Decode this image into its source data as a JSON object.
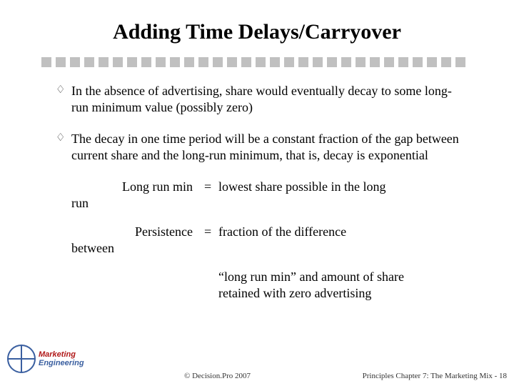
{
  "title": "Adding Time Delays/Carryover",
  "bullets": [
    "In the absence of advertising, share would eventually decay to some long-run minimum value (possibly zero)",
    "The decay in one time period will be a constant fraction of the gap between current share and the long-run minimum, that is, decay is exponential"
  ],
  "definitions": [
    {
      "term_line1": "Long run min",
      "term_line2": "run",
      "eq": "=",
      "desc": "lowest share possible in the long"
    },
    {
      "term_line1": "Persistence",
      "term_line2": "between",
      "eq": "=",
      "desc": "fraction of the difference"
    }
  ],
  "closing_lines": [
    "“long run min” and amount of share",
    "retained with zero advertising"
  ],
  "logo": {
    "line1": "Marketing",
    "line2": "Engineering"
  },
  "footer": {
    "copyright": "©  Decision.Pro 2007",
    "pageref": "Principles Chapter 7: The Marketing Mix -  18"
  }
}
